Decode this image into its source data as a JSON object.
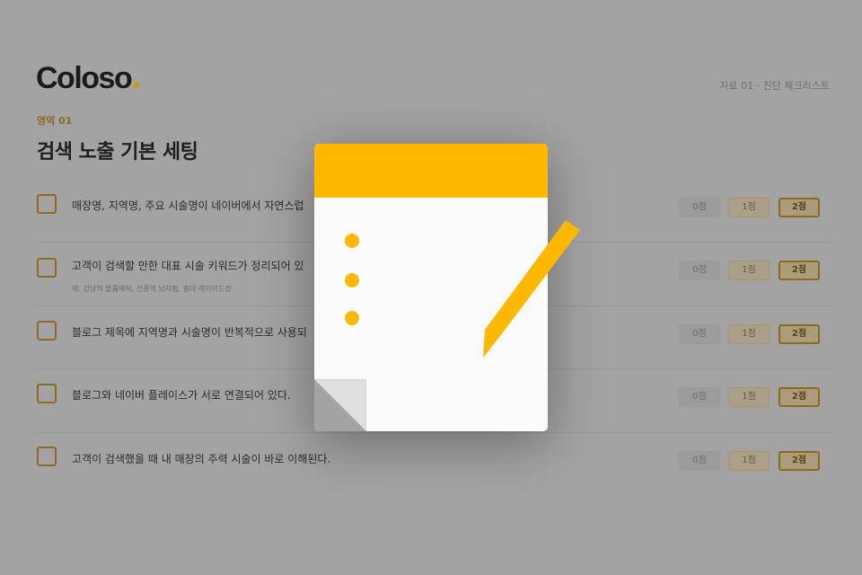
{
  "header": {
    "logo_text": "Coloso",
    "doc_label": "자료 01 · 진단 체크리스트"
  },
  "section": {
    "label": "영역 01",
    "title": "검색 노출 기본 세팅"
  },
  "items": [
    {
      "text": "매장명, 지역명, 주요 시술명이 네이버에서 자연스럽",
      "example": ""
    },
    {
      "text": "고객이 검색할 만한 대표 시술 키워드가 정리되어 있",
      "example": "예: 강남역 볼륨매직, 선릉역 남자펌, 홍대 레이어드컷"
    },
    {
      "text": "블로그 제목에 지역명과 시술명이 반복적으로 사용되",
      "example": ""
    },
    {
      "text": "블로그와 네이버 플레이스가 서로 연결되어 있다.",
      "example": ""
    },
    {
      "text": "고객이 검색했을 때 내 매장의 주력 시술이 바로 이해된다.",
      "example": ""
    }
  ],
  "scores": [
    "0점",
    "1점",
    "2점"
  ],
  "colors": {
    "accent": "#ffb800",
    "logo_dot": "#c99a1c",
    "overlay_bg": "#a3a3a3",
    "note_paper": "#fafafa"
  },
  "illustration": {
    "icon": "notepad-with-pencil-icon"
  }
}
